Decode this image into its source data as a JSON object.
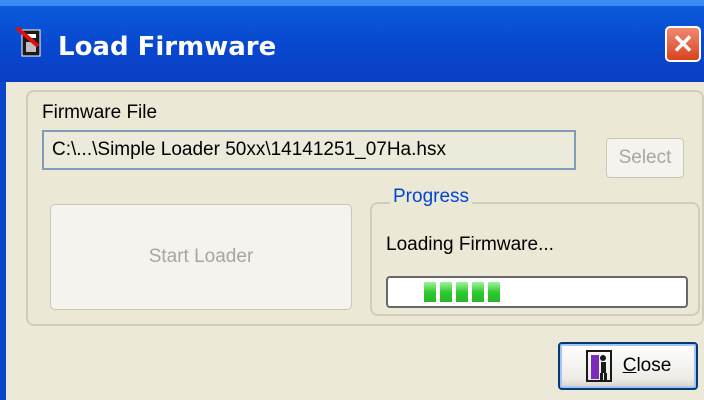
{
  "window": {
    "title": "Load Firmware",
    "close_glyph": "✕"
  },
  "firmware": {
    "label": "Firmware File",
    "path": "C:\\...\\Simple Loader 50xx\\14141251_07Ha.hsx",
    "select_label": "Select"
  },
  "start_loader_label": "Start Loader",
  "progress": {
    "group_label": "Progress",
    "status": "Loading Firmware...",
    "fraction": 0.45,
    "segments": 5
  },
  "close_button": {
    "label_first": "C",
    "label_rest": "lose"
  },
  "icons": {
    "app": "firmware-app-icon",
    "close_button": "door-exit-icon"
  },
  "colors": {
    "titlebar": "#0848d0",
    "progress_green": "#2fca2f",
    "legend_blue": "#0046d5",
    "close_red": "#d8431f"
  }
}
